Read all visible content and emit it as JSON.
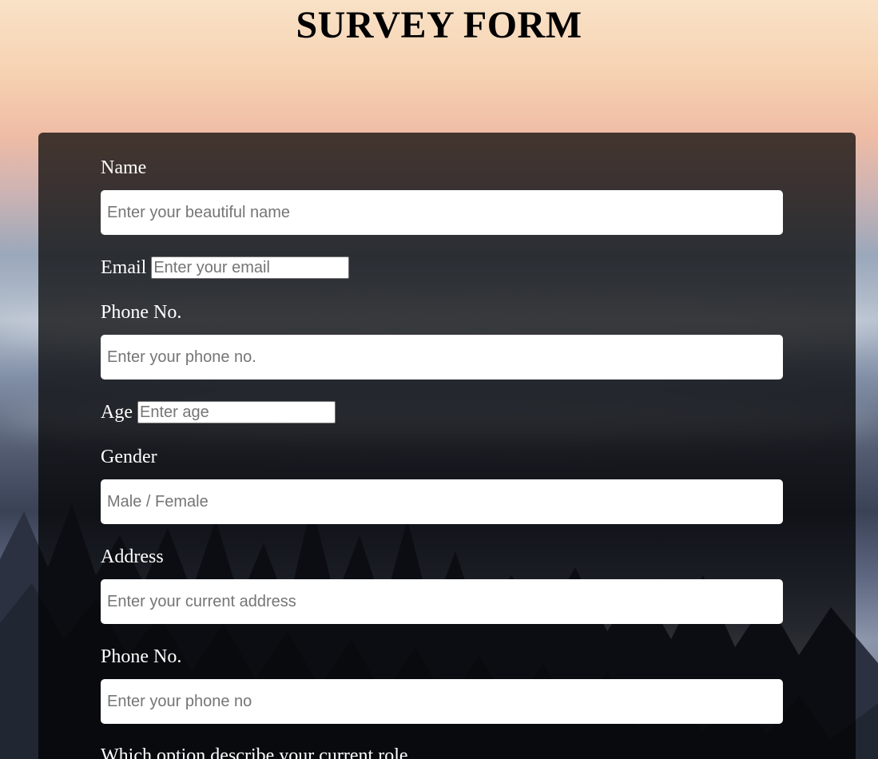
{
  "page": {
    "title": "SURVEY FORM"
  },
  "form": {
    "name": {
      "label": "Name",
      "placeholder": "Enter your beautiful name"
    },
    "email": {
      "label": "Email",
      "placeholder": "Enter your email"
    },
    "phone": {
      "label": "Phone No.",
      "placeholder": "Enter your phone no."
    },
    "age": {
      "label": "Age",
      "placeholder": "Enter age"
    },
    "gender": {
      "label": "Gender",
      "placeholder": "Male / Female"
    },
    "address": {
      "label": "Address",
      "placeholder": "Enter your current address"
    },
    "phone2": {
      "label": "Phone No.",
      "placeholder": "Enter your phone no"
    },
    "role_question": {
      "label": "Which option describe your current role"
    }
  }
}
